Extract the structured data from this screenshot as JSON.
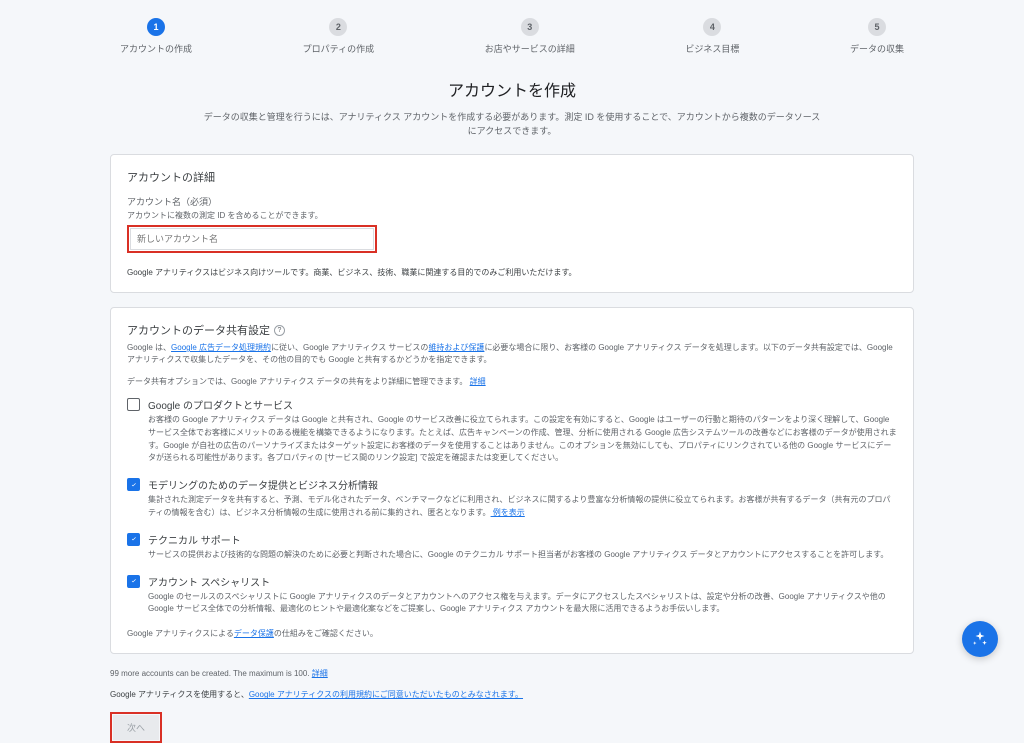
{
  "stepper": [
    {
      "num": "1",
      "label": "アカウントの作成",
      "active": true
    },
    {
      "num": "2",
      "label": "プロパティの作成",
      "active": false
    },
    {
      "num": "3",
      "label": "お店やサービスの詳細",
      "active": false
    },
    {
      "num": "4",
      "label": "ビジネス目標",
      "active": false
    },
    {
      "num": "5",
      "label": "データの収集",
      "active": false
    }
  ],
  "page": {
    "title": "アカウントを作成",
    "subtitle": "データの収集と管理を行うには、アナリティクス アカウントを作成する必要があります。測定 ID を使用することで、アカウントから複数のデータソースにアクセスできます。"
  },
  "details_card": {
    "title": "アカウントの詳細",
    "field_label": "アカウント名（必須）",
    "field_hint": "アカウントに複数の測定 ID を含めることができます。",
    "placeholder": "新しいアカウント名",
    "note": "Google アナリティクスはビジネス向けツールです。商業、ビジネス、技術、職業に関連する目的でのみご利用いただけます。"
  },
  "share_card": {
    "heading": "アカウントのデータ共有設定",
    "desc_pre": "Google は、",
    "desc_link1": "Google 広告データ処理規約",
    "desc_mid1": "に従い、Google アナリティクス サービスの",
    "desc_link2": "維持および保護",
    "desc_post": "に必要な場合に限り、お客様の Google アナリティクス データを処理します。以下のデータ共有設定では、Google アナリティクスで収集したデータを、その他の目的でも Google と共有するかどうかを指定できます。",
    "sub_desc": "データ共有オプションでは、Google アナリティクス データの共有をより詳細に管理できます。",
    "sub_link": "詳細",
    "options": [
      {
        "title": "Google のプロダクトとサービス",
        "checked": false,
        "desc": "お客様の Google アナリティクス データは Google と共有され、Google のサービス改善に役立てられます。この設定を有効にすると、Google はユーザーの行動と期待のパターンをより深く理解して、Google サービス全体でお客様にメリットのある機能を構築できるようになります。たとえば、広告キャンペーンの作成、管理、分析に使用される Google 広告システムツールの改善などにお客様のデータが使用されます。Google が自社の広告のパーソナライズまたはターゲット設定にお客様のデータを使用することはありません。このオプションを無効にしても、プロパティにリンクされている他の Google サービスにデータが送られる可能性があります。各プロパティの [サービス間のリンク設定] で設定を確認または変更してください。",
        "example": ""
      },
      {
        "title": "モデリングのためのデータ提供とビジネス分析情報",
        "checked": true,
        "desc": "集計された測定データを共有すると、予測、モデル化されたデータ、ベンチマークなどに利用され、ビジネスに関するより豊富な分析情報の提供に役立てられます。お客様が共有するデータ（共有元のプロパティの情報を含む）は、ビジネス分析情報の生成に使用される前に集約され、匿名となります。",
        "example": "例を表示"
      },
      {
        "title": "テクニカル サポート",
        "checked": true,
        "desc": "サービスの提供および技術的な問題の解決のために必要と判断された場合に、Google のテクニカル サポート担当者がお客様の Google アナリティクス データとアカウントにアクセスすることを許可します。",
        "example": ""
      },
      {
        "title": "アカウント スペシャリスト",
        "checked": true,
        "desc": "Google のセールスのスペシャリストに Google アナリティクスのデータとアカウントへのアクセス権を与えます。データにアクセスしたスペシャリストは、設定や分析の改善、Google アナリティクスや他の Google サービス全体での分析情報、最適化のヒントや最適化案などをご提案し、Google アナリティクス アカウントを最大限に活用できるようお手伝いします。",
        "example": ""
      }
    ],
    "footer_pre": "Google アナリティクスによる",
    "footer_link": "データ保護",
    "footer_post": "の仕組みをご確認ください。"
  },
  "below": {
    "accounts_note": "99 more accounts can be created. The maximum is 100.",
    "accounts_link": "詳細",
    "tos_pre": "Google アナリティクスを使用すると、",
    "tos_link": "Google アナリティクスの利用規約にご同意いただいたものとみなされます。",
    "next_label": "次へ"
  }
}
